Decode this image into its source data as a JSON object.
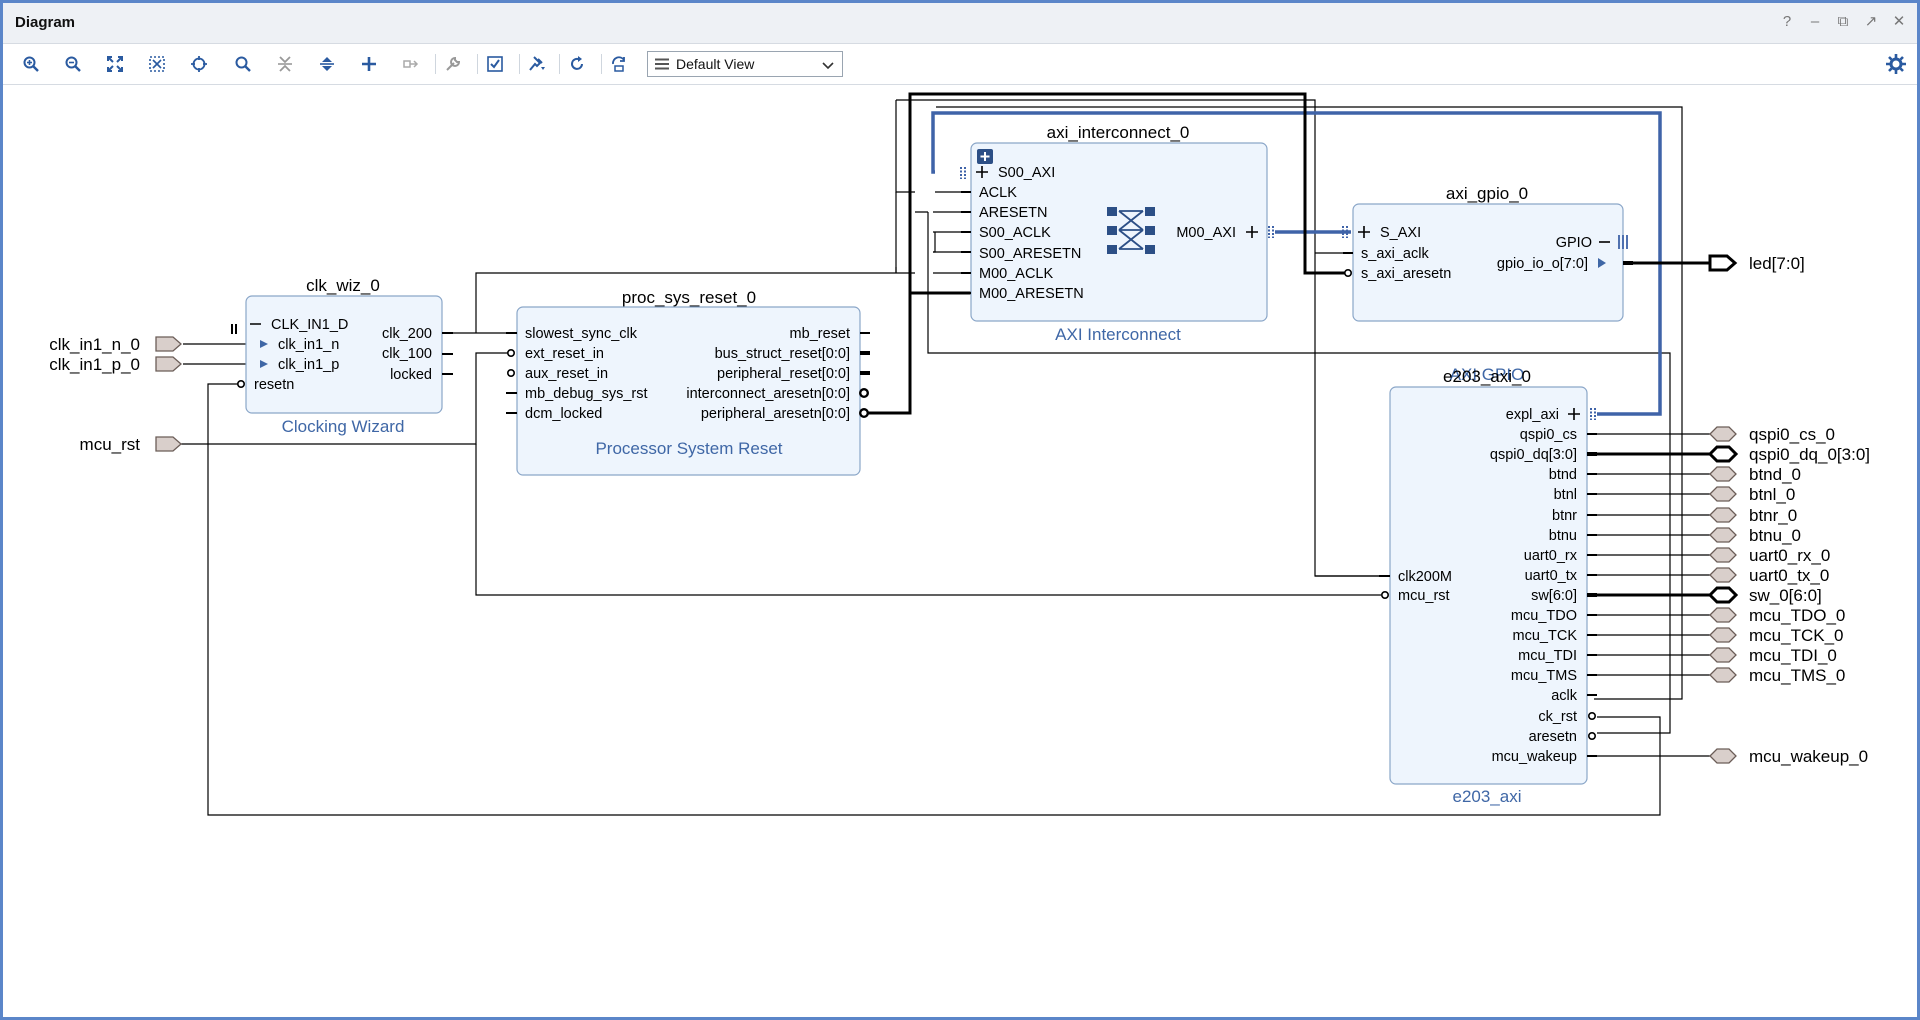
{
  "window": {
    "title": "Diagram"
  },
  "toolbar": {
    "view_select": "Default View"
  },
  "blocks": {
    "clk_wiz": {
      "instance": "clk_wiz_0",
      "name": "Clocking Wizard",
      "pins": {
        "clk_in1_d": "CLK_IN1_D",
        "clk_in1_n": "clk_in1_n",
        "clk_in1_p": "clk_in1_p",
        "resetn": "resetn",
        "clk_200": "clk_200",
        "clk_100": "clk_100",
        "locked": "locked"
      }
    },
    "proc_sys_reset": {
      "instance": "proc_sys_reset_0",
      "name": "Processor System Reset",
      "pins": {
        "slowest_sync_clk": "slowest_sync_clk",
        "ext_reset_in": "ext_reset_in",
        "aux_reset_in": "aux_reset_in",
        "mb_debug_sys_rst": "mb_debug_sys_rst",
        "dcm_locked": "dcm_locked",
        "mb_reset": "mb_reset",
        "bus_struct_reset": "bus_struct_reset[0:0]",
        "peripheral_reset": "peripheral_reset[0:0]",
        "interconnect_aresetn": "interconnect_aresetn[0:0]",
        "peripheral_aresetn": "peripheral_aresetn[0:0]"
      }
    },
    "axi_interconnect": {
      "instance": "axi_interconnect_0",
      "name": "AXI Interconnect",
      "pins": {
        "s00_axi": "S00_AXI",
        "aclk": "ACLK",
        "aresetn": "ARESETN",
        "s00_aclk": "S00_ACLK",
        "s00_aresetn": "S00_ARESETN",
        "m00_aclk": "M00_ACLK",
        "m00_aresetn": "M00_ARESETN",
        "m00_axi": "M00_AXI"
      }
    },
    "axi_gpio": {
      "instance": "axi_gpio_0",
      "name": "AXI GPIO",
      "pins": {
        "s_axi": "S_AXI",
        "s_axi_aclk": "s_axi_aclk",
        "s_axi_aresetn": "s_axi_aresetn",
        "gpio": "GPIO",
        "gpio_io_o": "gpio_io_o[7:0]"
      }
    },
    "e203_axi": {
      "instance": "e203_axi_0",
      "name": "e203_axi",
      "left_pins": {
        "clk200m": "clk200M",
        "mcu_rst": "mcu_rst"
      },
      "right_pins": [
        "expl_axi",
        "qspi0_cs",
        "qspi0_dq[3:0]",
        "btnd",
        "btnl",
        "btnr",
        "btnu",
        "uart0_rx",
        "uart0_tx",
        "sw[6:0]",
        "mcu_TDO",
        "mcu_TCK",
        "mcu_TDI",
        "mcu_TMS",
        "aclk",
        "ck_rst",
        "aresetn",
        "mcu_wakeup"
      ]
    }
  },
  "ports": {
    "left": [
      "clk_in1_n_0",
      "clk_in1_p_0",
      "mcu_rst"
    ],
    "led": "led[7:0]",
    "right": [
      "qspi0_cs_0",
      "qspi0_dq_0[3:0]",
      "btnd_0",
      "btnl_0",
      "btnr_0",
      "btnu_0",
      "uart0_rx_0",
      "uart0_tx_0",
      "sw_0[6:0]",
      "mcu_TDO_0",
      "mcu_TCK_0",
      "mcu_TDI_0",
      "mcu_TMS_0",
      "mcu_wakeup_0"
    ]
  },
  "icons": {
    "toolbar": [
      "zoom-in-icon",
      "zoom-out-icon",
      "zoom-fit-icon",
      "zoom-area-icon",
      "center-icon",
      "search-icon",
      "collapse-icon",
      "expand-icon",
      "add-ip-icon",
      "connect-icon",
      "wrench-icon",
      "validate-icon",
      "pin-icon",
      "refresh-icon",
      "regenerate-icon"
    ],
    "window": [
      "help-icon",
      "minimize-icon",
      "restore-icon",
      "float-icon",
      "close-icon"
    ]
  },
  "colors": {
    "block_fill": "#eef5fd",
    "block_border": "#8aa6c8",
    "block_name": "#3f67a6",
    "bus_blue": "#3f63a8",
    "frame_border": "#5b86c9"
  }
}
